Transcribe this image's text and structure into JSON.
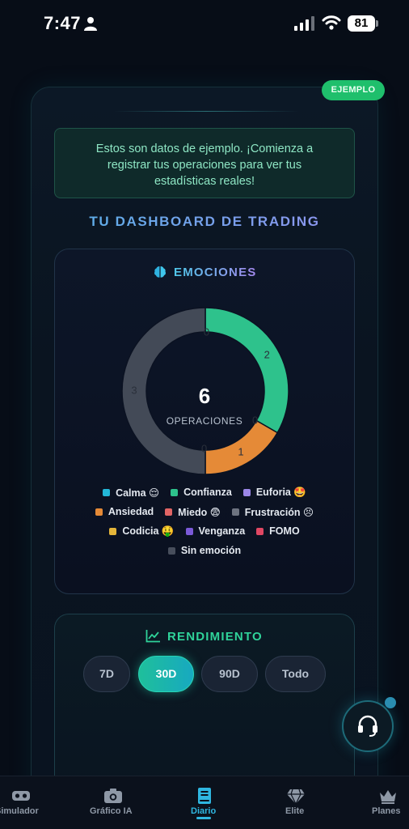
{
  "status_bar": {
    "time": "7:47",
    "battery": "81"
  },
  "badge": "EJEMPLO",
  "notice": "Estos son datos de ejemplo. ¡Comienza a registrar tus operaciones para ver tus estadísticas reales!",
  "dashboard_title": "TU DASHBOARD DE TRADING",
  "emotions": {
    "title": "EMOCIONES",
    "total_value": "6",
    "total_label": "OPERACIONES",
    "colors": {
      "confianza": "#2ec28c",
      "ansiedad": "#e58a37",
      "frustracion": "#434a57"
    },
    "legend": [
      {
        "label": "Calma 😌",
        "color": "#23b7d8"
      },
      {
        "label": "Confianza",
        "color": "#2ec28c"
      },
      {
        "label": "Euforia 🤩",
        "color": "#9b87e8"
      },
      {
        "label": "Ansiedad",
        "color": "#e58a37"
      },
      {
        "label": "Miedo 😨",
        "color": "#e16565"
      },
      {
        "label": "Frustración 😣",
        "color": "#6d7380"
      },
      {
        "label": "Codicia 🤑",
        "color": "#e4b53a"
      },
      {
        "label": "Venganza",
        "color": "#7b5ad8"
      },
      {
        "label": "FOMO",
        "color": "#e04763"
      },
      {
        "label": "Sin emoción",
        "color": "#474e5c"
      }
    ]
  },
  "chart_data": {
    "type": "pie",
    "title": "EMOCIONES",
    "categories": [
      "Confianza",
      "Ansiedad",
      "Frustración"
    ],
    "values": [
      2,
      1,
      3
    ],
    "zero_labels": [
      "0",
      "0",
      "0"
    ],
    "slice_labels": [
      "2",
      "1",
      "3"
    ],
    "center_value": "6",
    "center_label": "OPERACIONES"
  },
  "performance": {
    "title": "RENDIMIENTO",
    "ranges": [
      "7D",
      "30D",
      "90D",
      "Todo"
    ],
    "selected": "30D"
  },
  "nav": {
    "items": [
      {
        "label": "Simulador"
      },
      {
        "label": "Gráfico IA"
      },
      {
        "label": "Diario"
      },
      {
        "label": "Elite"
      },
      {
        "label": "Planes"
      }
    ],
    "active": "Diario"
  }
}
